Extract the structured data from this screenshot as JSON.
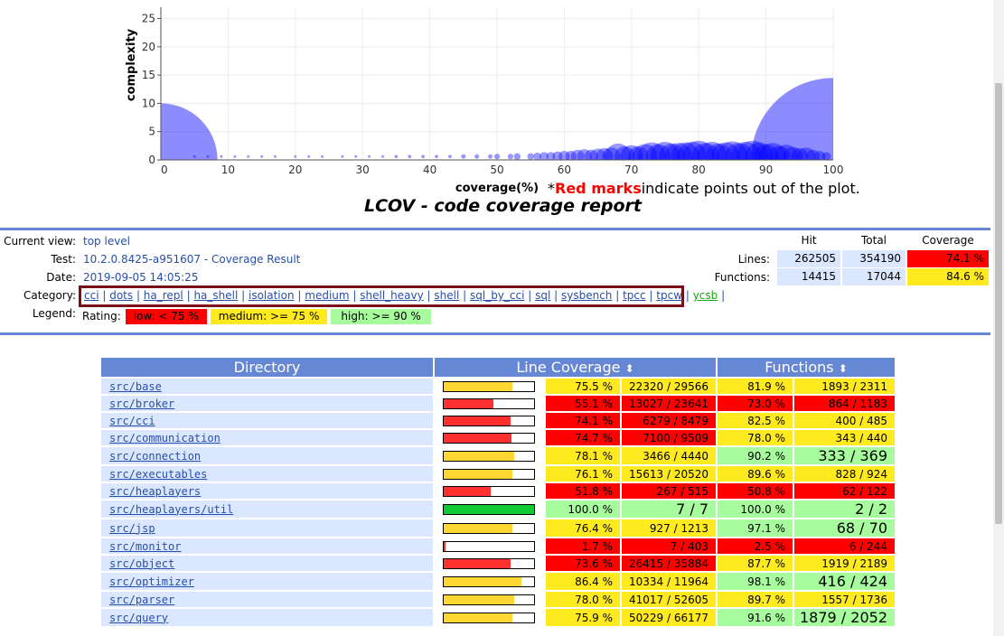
{
  "chart_data": {
    "type": "scatter",
    "xlabel": "coverage(%)",
    "ylabel": "complexity",
    "xlim": [
      0,
      100
    ],
    "ylim": [
      0,
      27
    ],
    "x_ticks": [
      "0",
      "10",
      "20",
      "30",
      "40",
      "50",
      "60",
      "70",
      "80",
      "90",
      "100"
    ],
    "y_ticks": [
      "0",
      "5",
      "10",
      "15",
      "20",
      "25"
    ],
    "series": [
      {
        "points": [
          {
            "x": 0,
            "y": 0,
            "r": 10
          },
          {
            "x": 100,
            "y": 0,
            "r": 14.5
          },
          {
            "x": 5,
            "y": 1,
            "r": 0.2
          },
          {
            "x": 7,
            "y": 1,
            "r": 0.2
          },
          {
            "x": 9,
            "y": 1,
            "r": 0.2
          },
          {
            "x": 11,
            "y": 1,
            "r": 0.2
          },
          {
            "x": 13,
            "y": 1,
            "r": 0.2
          },
          {
            "x": 15,
            "y": 1,
            "r": 0.2
          },
          {
            "x": 17,
            "y": 1,
            "r": 0.2
          },
          {
            "x": 20,
            "y": 1,
            "r": 0.2
          },
          {
            "x": 22,
            "y": 1,
            "r": 0.2
          },
          {
            "x": 24,
            "y": 1,
            "r": 0.2
          },
          {
            "x": 27,
            "y": 1,
            "r": 0.2
          },
          {
            "x": 29,
            "y": 1,
            "r": 0.2
          },
          {
            "x": 31,
            "y": 1,
            "r": 0.2
          },
          {
            "x": 33,
            "y": 1,
            "r": 0.2
          },
          {
            "x": 35,
            "y": 1,
            "r": 0.3
          },
          {
            "x": 37,
            "y": 1,
            "r": 0.3
          },
          {
            "x": 39,
            "y": 1,
            "r": 0.3
          },
          {
            "x": 41,
            "y": 1,
            "r": 0.3
          },
          {
            "x": 43,
            "y": 1,
            "r": 0.3
          },
          {
            "x": 45,
            "y": 1,
            "r": 0.4
          },
          {
            "x": 47,
            "y": 1,
            "r": 0.4
          },
          {
            "x": 49,
            "y": 1,
            "r": 0.4
          },
          {
            "x": 50,
            "y": 1,
            "r": 0.5
          },
          {
            "x": 52,
            "y": 1,
            "r": 0.5
          },
          {
            "x": 53,
            "y": 1,
            "r": 0.6
          },
          {
            "x": 55,
            "y": 1,
            "r": 0.6
          },
          {
            "x": 56,
            "y": 1,
            "r": 0.7
          },
          {
            "x": 57,
            "y": 1,
            "r": 0.8
          },
          {
            "x": 58,
            "y": 1,
            "r": 0.8
          },
          {
            "x": 59,
            "y": 1,
            "r": 0.9
          },
          {
            "x": 60,
            "y": 1,
            "r": 1.0
          },
          {
            "x": 61,
            "y": 1,
            "r": 1.0
          },
          {
            "x": 62,
            "y": 1,
            "r": 1.2
          },
          {
            "x": 63,
            "y": 1,
            "r": 1.3
          },
          {
            "x": 64,
            "y": 1,
            "r": 1.2
          },
          {
            "x": 65,
            "y": 1,
            "r": 1.4
          },
          {
            "x": 66,
            "y": 1,
            "r": 1.5
          },
          {
            "x": 67,
            "y": 1,
            "r": 1.6
          },
          {
            "x": 68,
            "y": 1,
            "r": 2.3
          },
          {
            "x": 69,
            "y": 1,
            "r": 1.8
          },
          {
            "x": 70,
            "y": 1,
            "r": 2.0
          },
          {
            "x": 71,
            "y": 1,
            "r": 1.8
          },
          {
            "x": 72,
            "y": 1,
            "r": 2.2
          },
          {
            "x": 73,
            "y": 1,
            "r": 2.5
          },
          {
            "x": 74,
            "y": 1,
            "r": 2.2
          },
          {
            "x": 75,
            "y": 1,
            "r": 2.6
          },
          {
            "x": 76,
            "y": 1,
            "r": 2.3
          },
          {
            "x": 77,
            "y": 1,
            "r": 2.4
          },
          {
            "x": 78,
            "y": 1,
            "r": 2.5
          },
          {
            "x": 79,
            "y": 1,
            "r": 2.6
          },
          {
            "x": 80,
            "y": 1,
            "r": 2.8
          },
          {
            "x": 81,
            "y": 1,
            "r": 2.4
          },
          {
            "x": 82,
            "y": 1,
            "r": 2.6
          },
          {
            "x": 83,
            "y": 1,
            "r": 2.3
          },
          {
            "x": 84,
            "y": 1,
            "r": 2.5
          },
          {
            "x": 85,
            "y": 1,
            "r": 2.7
          },
          {
            "x": 86,
            "y": 1,
            "r": 2.4
          },
          {
            "x": 87,
            "y": 1,
            "r": 2.6
          },
          {
            "x": 88,
            "y": 1,
            "r": 2.8
          },
          {
            "x": 89,
            "y": 1,
            "r": 2.5
          },
          {
            "x": 90,
            "y": 1,
            "r": 2.2
          },
          {
            "x": 91,
            "y": 1,
            "r": 2.4
          },
          {
            "x": 92,
            "y": 1,
            "r": 1.9
          },
          {
            "x": 93,
            "y": 1,
            "r": 2.1
          },
          {
            "x": 94,
            "y": 1,
            "r": 1.7
          },
          {
            "x": 95,
            "y": 1,
            "r": 1.5
          },
          {
            "x": 96,
            "y": 1,
            "r": 1.6
          },
          {
            "x": 97,
            "y": 1,
            "r": 1.2
          },
          {
            "x": 98,
            "y": 1,
            "r": 1.0
          },
          {
            "x": 99,
            "y": 1,
            "r": 0.8
          }
        ]
      }
    ],
    "point_color": "#0000ff",
    "grid": true
  },
  "note": {
    "prefix": "*",
    "red": "Red marks",
    "rest": "indicate points out of the plot."
  },
  "title": "LCOV - code coverage report",
  "header": {
    "current_view_label": "Current view:",
    "current_view": "top level",
    "test_label": "Test:",
    "test": "10.2.0.8425-a951607 - Coverage Result",
    "date_label": "Date:",
    "date": "2019-09-05 14:05:25",
    "category_label": "Category:",
    "categories": [
      "cci",
      "dots",
      "ha_repl",
      "ha_shell",
      "isolation",
      "medium",
      "shell_heavy",
      "shell",
      "sql_by_cci",
      "sql",
      "sysbench",
      "tpcc",
      "tpcw",
      "ycsb"
    ],
    "legend_label": "Legend:",
    "rating_label": "Rating:",
    "rating_low": "low: < 75 %",
    "rating_medium": "medium: >= 75 %",
    "rating_high": "high: >= 90 %"
  },
  "summary": {
    "col_hit": "Hit",
    "col_total": "Total",
    "col_coverage": "Coverage",
    "lines_label": "Lines:",
    "lines_hit": "262505",
    "lines_total": "354190",
    "lines_cov": "74.1 %",
    "functions_label": "Functions:",
    "functions_hit": "14415",
    "functions_total": "17044",
    "functions_cov": "84.6 %"
  },
  "table": {
    "col_directory": "Directory",
    "col_line": "Line Coverage",
    "col_functions": "Functions",
    "sort_icon": "⬍",
    "rows": [
      {
        "name": "src/base",
        "line_pct": "75.5 %",
        "line_cnt": "22320 / 29566",
        "fn_pct": "81.9 %",
        "fn_cnt": "1893 / 2311",
        "lp": 75.5,
        "lr": "med",
        "fr": "med",
        "big_l": false,
        "big_f": false
      },
      {
        "name": "src/broker",
        "line_pct": "55.1 %",
        "line_cnt": "13027 / 23641",
        "fn_pct": "73.0 %",
        "fn_cnt": "864 / 1183",
        "lp": 55.1,
        "lr": "lo",
        "fr": "lo",
        "big_l": false,
        "big_f": false
      },
      {
        "name": "src/cci",
        "line_pct": "74.1 %",
        "line_cnt": "6279 / 8479",
        "fn_pct": "82.5 %",
        "fn_cnt": "400 / 485",
        "lp": 74.1,
        "lr": "lo",
        "fr": "med",
        "big_l": false,
        "big_f": false
      },
      {
        "name": "src/communication",
        "line_pct": "74.7 %",
        "line_cnt": "7100 / 9509",
        "fn_pct": "78.0 %",
        "fn_cnt": "343 / 440",
        "lp": 74.7,
        "lr": "lo",
        "fr": "med",
        "big_l": false,
        "big_f": false
      },
      {
        "name": "src/connection",
        "line_pct": "78.1 %",
        "line_cnt": "3466 / 4440",
        "fn_pct": "90.2 %",
        "fn_cnt": "333 / 369",
        "lp": 78.1,
        "lr": "med",
        "fr": "hi",
        "big_l": false,
        "big_f": true
      },
      {
        "name": "src/executables",
        "line_pct": "76.1 %",
        "line_cnt": "15613 / 20520",
        "fn_pct": "89.6 %",
        "fn_cnt": "828 / 924",
        "lp": 76.1,
        "lr": "med",
        "fr": "med",
        "big_l": false,
        "big_f": false
      },
      {
        "name": "src/heaplayers",
        "line_pct": "51.8 %",
        "line_cnt": "267 / 515",
        "fn_pct": "50.8 %",
        "fn_cnt": "62 / 122",
        "lp": 51.8,
        "lr": "lo",
        "fr": "lo",
        "big_l": false,
        "big_f": false
      },
      {
        "name": "src/heaplayers/util",
        "line_pct": "100.0 %",
        "line_cnt": "7 / 7",
        "fn_pct": "100.0 %",
        "fn_cnt": "2 / 2",
        "lp": 100,
        "lr": "hi",
        "fr": "hi",
        "big_l": true,
        "big_f": true
      },
      {
        "name": "src/jsp",
        "line_pct": "76.4 %",
        "line_cnt": "927 / 1213",
        "fn_pct": "97.1 %",
        "fn_cnt": "68 / 70",
        "lp": 76.4,
        "lr": "med",
        "fr": "hi",
        "big_l": false,
        "big_f": true
      },
      {
        "name": "src/monitor",
        "line_pct": "1.7 %",
        "line_cnt": "7 / 403",
        "fn_pct": "2.5 %",
        "fn_cnt": "6 / 244",
        "lp": 1.7,
        "lr": "lo",
        "fr": "lo",
        "big_l": false,
        "big_f": false
      },
      {
        "name": "src/object",
        "line_pct": "73.6 %",
        "line_cnt": "26415 / 35884",
        "fn_pct": "87.7 %",
        "fn_cnt": "1919 / 2189",
        "lp": 73.6,
        "lr": "lo",
        "fr": "med",
        "big_l": false,
        "big_f": false
      },
      {
        "name": "src/optimizer",
        "line_pct": "86.4 %",
        "line_cnt": "10334 / 11964",
        "fn_pct": "98.1 %",
        "fn_cnt": "416 / 424",
        "lp": 86.4,
        "lr": "med",
        "fr": "hi",
        "big_l": false,
        "big_f": true
      },
      {
        "name": "src/parser",
        "line_pct": "78.0 %",
        "line_cnt": "41017 / 52605",
        "fn_pct": "89.7 %",
        "fn_cnt": "1557 / 1736",
        "lp": 78.0,
        "lr": "med",
        "fr": "med",
        "big_l": false,
        "big_f": false
      },
      {
        "name": "src/query",
        "line_pct": "75.9 %",
        "line_cnt": "50229 / 66177",
        "fn_pct": "91.6 %",
        "fn_cnt": "1879 / 2052",
        "lp": 75.9,
        "lr": "med",
        "fr": "hi",
        "big_l": false,
        "big_f": true
      }
    ]
  },
  "colors": {
    "low": "#ff0000",
    "medium": "#ffea20",
    "high": "#a7fc9d",
    "bar_low": "#ff3030",
    "bar_med": "#ffd733",
    "bar_high": "#10c935",
    "header_blue": "#6688d4"
  }
}
